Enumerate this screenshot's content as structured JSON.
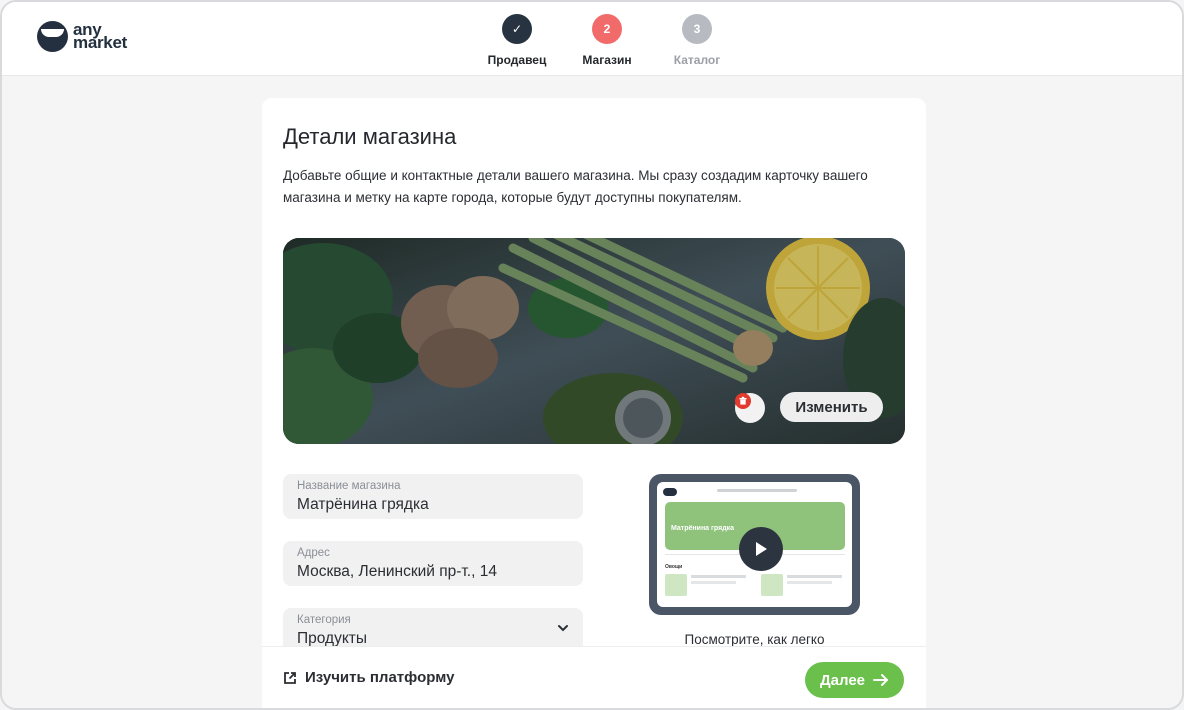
{
  "header": {
    "logo": {
      "line1": "any",
      "line2": "market"
    },
    "steps": [
      {
        "number": "✓",
        "label": "Продавец",
        "state": "done"
      },
      {
        "number": "2",
        "label": "Магазин",
        "state": "active"
      },
      {
        "number": "3",
        "label": "Каталог",
        "state": "todo"
      }
    ]
  },
  "card": {
    "title": "Детали магазина",
    "description": "Добавьте общие и контактные детали вашего магазина. Мы сразу создадим карточку вашего магазина и метку на карте города, которые будут доступны покупателям.",
    "cover": {
      "change_label": "Изменить",
      "delete_icon": "trash-icon"
    },
    "fields": {
      "name": {
        "label": "Название магазина",
        "value": "Матрёнина грядка"
      },
      "address": {
        "label": "Адрес",
        "value": "Москва, Ленинский пр-т., 14"
      },
      "category": {
        "label": "Категория",
        "value": "Продукты"
      }
    },
    "preview": {
      "shop_name": "Матрёнина грядка",
      "section": "Овощи",
      "caption": "Посмотрите, как легко"
    }
  },
  "footer": {
    "learn_label": "Изучить платформу",
    "next_label": "Далее"
  },
  "colors": {
    "accent_green": "#6ac04b",
    "step_active": "#f26b6b",
    "step_done": "#283342",
    "step_todo": "#b7bbc1"
  }
}
